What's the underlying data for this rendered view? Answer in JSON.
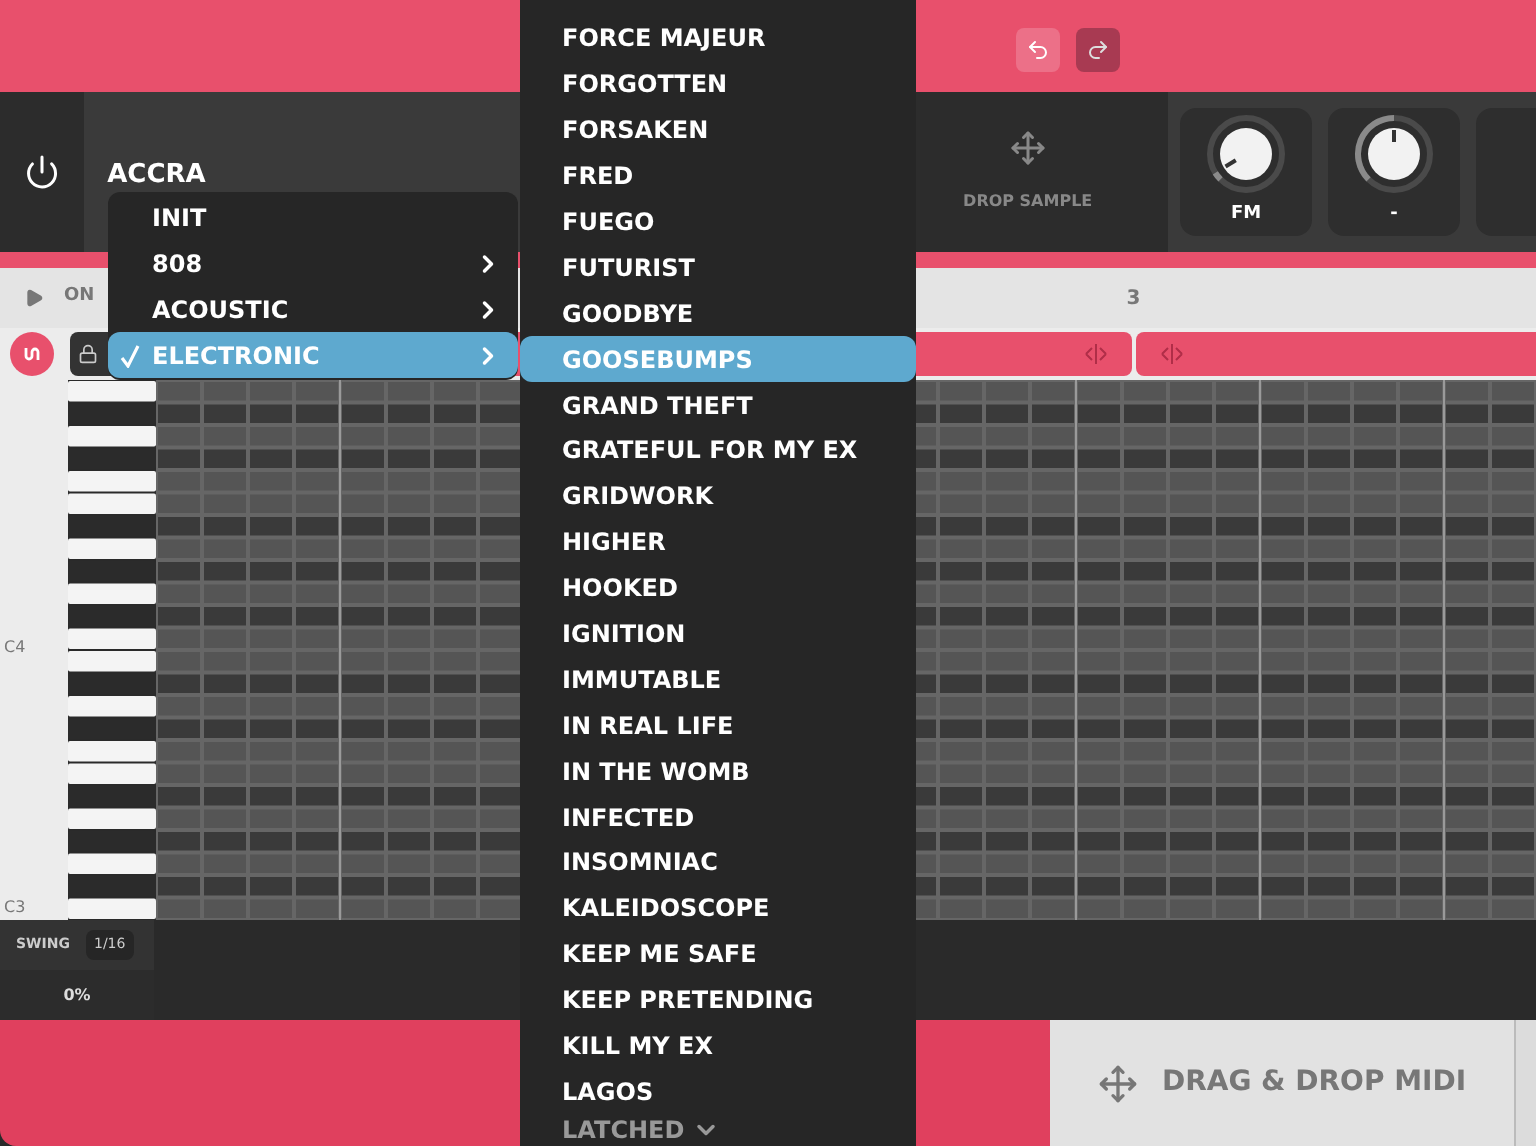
{
  "instrument": {
    "name": "ACCRA"
  },
  "drop_sample": {
    "label": "DROP SAMPLE"
  },
  "knobs": [
    {
      "label": "FM",
      "level": 0.05
    },
    {
      "label": "-",
      "level": 0.5
    }
  ],
  "transport": {
    "label": "ON"
  },
  "timeline": {
    "marker": "3"
  },
  "piano": {
    "labels": [
      "C4",
      "C3"
    ]
  },
  "swing": {
    "label": "SWING",
    "division": "1/16",
    "value": "0%"
  },
  "midi": {
    "label": "DRAG & DROP MIDI"
  },
  "category_menu": {
    "items": [
      {
        "label": "INIT",
        "submenu": false,
        "selected": false
      },
      {
        "label": "808",
        "submenu": true,
        "selected": false
      },
      {
        "label": "ACOUSTIC",
        "submenu": true,
        "selected": false
      },
      {
        "label": "ELECTRONIC",
        "submenu": true,
        "selected": true
      }
    ]
  },
  "preset_menu": {
    "items": [
      {
        "label": "FORCE MAJEUR",
        "selected": false
      },
      {
        "label": "FORGOTTEN",
        "selected": false
      },
      {
        "label": "FORSAKEN",
        "selected": false
      },
      {
        "label": "FRED",
        "selected": false
      },
      {
        "label": "FUEGO",
        "selected": false
      },
      {
        "label": "FUTURIST",
        "selected": false
      },
      {
        "label": "GOODBYE",
        "selected": false
      },
      {
        "label": "GOOSEBUMPS",
        "selected": true
      },
      {
        "label": "GRAND THEFT",
        "selected": false
      },
      {
        "label": "GRATEFUL FOR MY EX",
        "selected": false
      },
      {
        "label": "GRIDWORK",
        "selected": false
      },
      {
        "label": "HIGHER",
        "selected": false
      },
      {
        "label": "HOOKED",
        "selected": false
      },
      {
        "label": "IGNITION",
        "selected": false
      },
      {
        "label": "IMMUTABLE",
        "selected": false
      },
      {
        "label": "IN REAL LIFE",
        "selected": false
      },
      {
        "label": "IN THE WOMB",
        "selected": false
      },
      {
        "label": "INFECTED",
        "selected": false
      },
      {
        "label": "INSOMNIAC",
        "selected": false
      },
      {
        "label": "KALEIDOSCOPE",
        "selected": false
      },
      {
        "label": "KEEP ME SAFE",
        "selected": false
      },
      {
        "label": "KEEP PRETENDING",
        "selected": false
      },
      {
        "label": "KILL MY EX",
        "selected": false
      },
      {
        "label": "LAGOS",
        "selected": false
      }
    ],
    "more": "LATCHED"
  }
}
